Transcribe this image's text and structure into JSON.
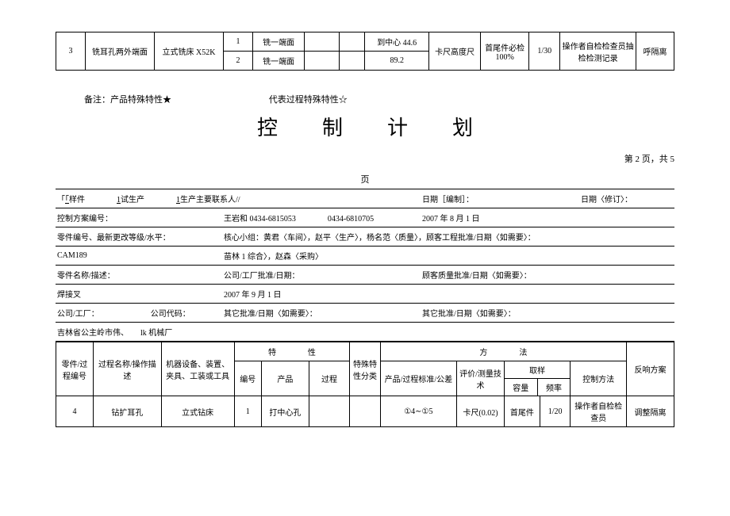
{
  "top_table": {
    "row_no": "3",
    "process_name": "铣耳孔两外端面",
    "machine": "立式铣床 X52K",
    "steps": [
      {
        "no": "1",
        "product": "铣一端面",
        "spec": "到中心 44.6"
      },
      {
        "no": "2",
        "product": "铣一端面",
        "spec": "89.2"
      }
    ],
    "eval": "卡尺高度尺",
    "sample1": "首尾件必检 100%",
    "sample2": "1/30",
    "ctrl": "操作者自检检查员抽检检测记录",
    "react": "呼隔离"
  },
  "notes": {
    "left": "备注：产品特殊特性★",
    "right": "代表过程特殊特性☆"
  },
  "title": "控制计划",
  "page_info": "第 2 页，共 5",
  "page_note": "页",
  "info": {
    "r1c1_a": "样件",
    "r1c1_b": "试生产",
    "r1c1_c": "生产主要联系人//",
    "r1c2": "日期［编制］：",
    "r1c3": "日期〈修订〉：",
    "r2c1": "控制方案编号：",
    "r2c2": "王岩和 0434-6815053　　　　0434-6810705",
    "r2c3": "2007 年 8 月 1 日",
    "r3c1": "零件编号、最新更改等级/水平：",
    "r3c2": "核心小组：黄君〈车间〉，赵平〈生产〉，杨名范〈质量〉，顾客工程批准/日期〈如需要〉：",
    "r4c1": "CAM189",
    "r4c2": "苗林 1 综合〉，赵森〈采购〉",
    "r5c1": "零件名称/描述：",
    "r5c2": "公司/工厂批准/日期：",
    "r5c3": "顾客质量批准/日期〈如需要〉：",
    "r6c1": "焊接叉",
    "r6c2": "2007 年 9 月 1 日",
    "r7c1": "公司/工厂：",
    "r7c2": "公司代码：",
    "r7c3": "其它批准/日期〈如需要〉：",
    "r7c4": "其它批准/日期〈如需要〉：",
    "r8c1": "吉林省公主岭市伟、　　lk 机械厂"
  },
  "header": {
    "c1": "零件/过程编号",
    "c2": "过程名称/操作描述",
    "c3": "机器设备、装置、夹具、工装或工具",
    "char": "特　　　　性",
    "char_no": "编号",
    "char_prod": "产品",
    "char_proc": "过程",
    "spec_class": "特殊特性分类",
    "method": "方　　　　法",
    "m1": "产品/过程标准/公差",
    "m2": "评价/测量技术",
    "m3": "取样",
    "m3a": "容量",
    "m3b": "频率",
    "m4": "控制方法",
    "react": "反响方案"
  },
  "data_row": {
    "no": "4",
    "proc": "钻扩耳孔",
    "mach": "立式钻床",
    "char_no": "1",
    "prod": "打中心孔",
    "proc_col": "",
    "spec_class": "",
    "std": "①4∼①5",
    "eval": "卡尺(0.02)",
    "cap": "首尾件",
    "freq": "1/20",
    "ctrl": "操作者自检检查员",
    "react": "调整隔离"
  }
}
